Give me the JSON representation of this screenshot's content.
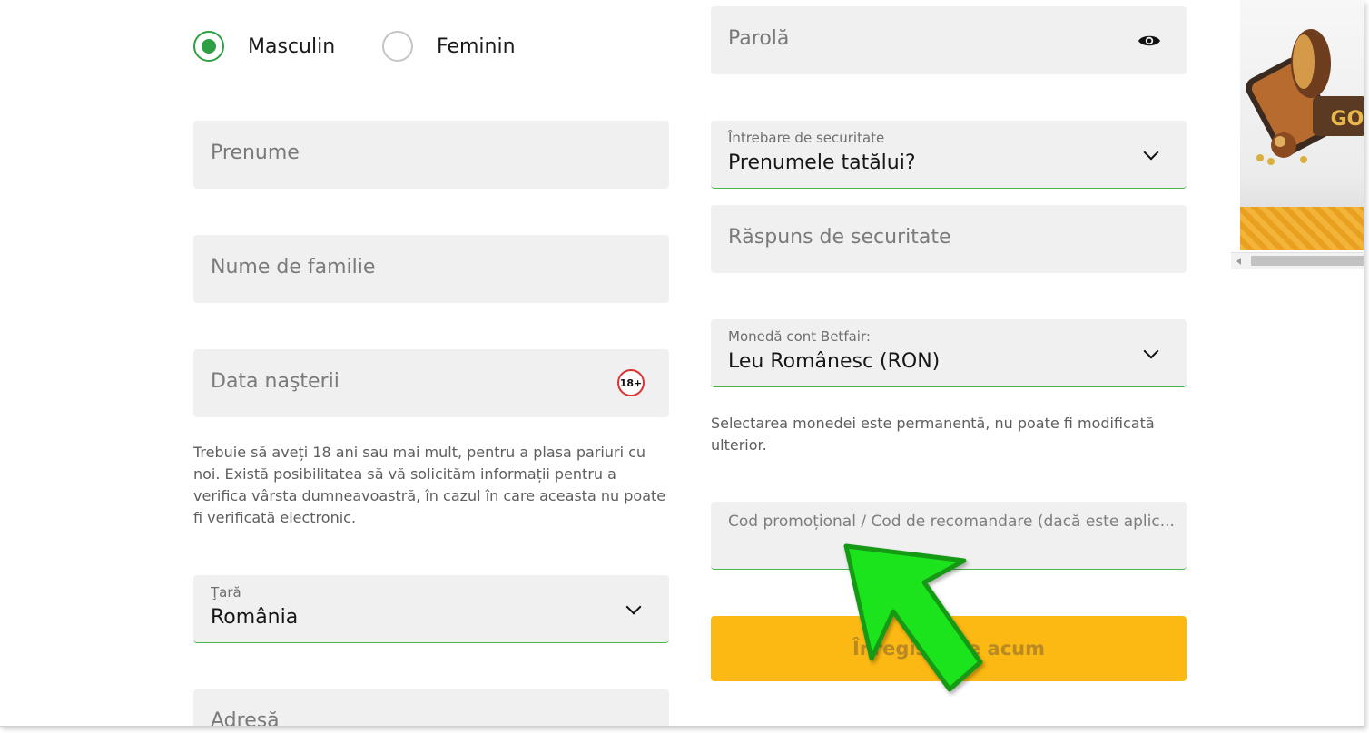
{
  "gender": {
    "male_label": "Masculin",
    "female_label": "Feminin",
    "selected": "Masculin"
  },
  "left": {
    "first_name_placeholder": "Prenume",
    "last_name_placeholder": "Nume de familie",
    "dob_placeholder": "Data naşterii",
    "age_badge": "18+",
    "age_help": "Trebuie să aveți 18 ani sau mai mult, pentru a plasa pariuri cu noi. Există posibilitatea să vă solicităm informații pentru a verifica vârsta dumneavoastră, în cazul în care aceasta nu poate fi verificată electronic.",
    "country_label": "Ţară",
    "country_value": "România",
    "address_placeholder": "Adresă"
  },
  "right": {
    "password_placeholder": "Parolă",
    "security_question_label": "Întrebare de securitate",
    "security_question_value": "Prenumele tatălui?",
    "security_answer_placeholder": "Răspuns de securitate",
    "currency_label": "Monedă cont Betfair:",
    "currency_value": "Leu Românesc (RON)",
    "currency_help": "Selectarea monedei este permanentă, nu poate fi modificată ulterior.",
    "promo_placeholder": "Cod promoțional / Cod de recomandare (dacă este aplic...",
    "submit_label": "Înregistrare acum"
  },
  "banner": {
    "text_fragment": "GO"
  },
  "colors": {
    "accent_green": "#2ea043",
    "submit_yellow": "#fdb913",
    "field_bg": "#f0f0f0",
    "arrow_green": "#1ee41e"
  },
  "icons": [
    "eye-icon",
    "chevron-down-icon",
    "age-18-badge",
    "pointer-arrow"
  ]
}
